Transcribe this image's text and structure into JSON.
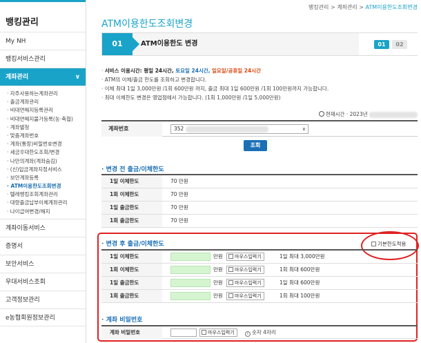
{
  "sidebar": {
    "title": "뱅킹관리",
    "items_top": [
      "My NH",
      "뱅킹서비스관리"
    ],
    "active": {
      "label": "계좌관리",
      "chevron": "∨"
    },
    "subitems": [
      "자주사용하는계좌관리",
      "출금계좌관리",
      "비대면해지등록관리",
      "비대면해지불가등록(농·축협)",
      "계좌별청",
      "맞춤계좌번호",
      "계좌(통장)비밀번호변경",
      "세금우대한도조회/변경",
      "나만의계좌(계좌숨김)",
      "(신)입금계좌지정서비스",
      "보안계좌등록",
      "ATM이용한도조회변경",
      "텔레뱅킹조회계좌관리",
      "대량출금납부이체계좌관리",
      "나이급여변경/해지"
    ],
    "subitem_active_index": 11,
    "items_bottom": [
      "계좌이동서비스",
      "증명서",
      "보안서비스",
      "우대서비스조회",
      "고객정보관리",
      "e농협회원정보관리"
    ]
  },
  "breadcrumb": {
    "home": "뱅킹관리",
    "sep": " > ",
    "level2": "계좌관리",
    "current": "ATM이용한도조회변경"
  },
  "page_title": "ATM이용한도조회변경",
  "steps": {
    "current_num": "01",
    "current_label": "ATM이용한도 변경",
    "pill_on": "01",
    "pill_off": "02"
  },
  "notes": {
    "hours_prefix": "서비스 이용시간: 평일 24시간,",
    "hours_sat": "토요일 24시간,",
    "hours_hol": "일요일/공휴일 24시간",
    "line2": "ATM의 이체/출금 한도를 조회하고 변경합니다.",
    "line3": "이체 최대 1일 3,000만원 /1회 600만원 까지, 출금 최대 1일 600만원 /1회 100만원까지 가능합니다.",
    "line4": "최대 이체한도 변경은 영업점에서 가능합니다. (1회 1,000만원 /1일 5,000만원)"
  },
  "current_time": "현재시간 · 2023년",
  "account": {
    "label": "계좌번호",
    "selected_prefix": "352",
    "dropdown_icon": "∨"
  },
  "lookup_button": "조회",
  "before": {
    "title": "변경 전 출금/이체한도",
    "rows": [
      {
        "label": "1일 이체한도",
        "value": "70 만원"
      },
      {
        "label": "1회 이체한도",
        "value": "70 만원"
      },
      {
        "label": "1일 출금한도",
        "value": "70 만원"
      },
      {
        "label": "1회 출금한도",
        "value": "70 만원"
      }
    ]
  },
  "after": {
    "title": "변경 후 출금/이체한도",
    "default_limit_label": "기본한도적용",
    "unit": "만원",
    "mouse_label": "마우스입력기",
    "rows": [
      {
        "label": "1일 이체한도",
        "max": "1일 최대 3,000만원"
      },
      {
        "label": "1회 이체한도",
        "max": "1회 최대 600만원"
      },
      {
        "label": "1일 출금한도",
        "max": "1일 최대 600만원"
      },
      {
        "label": "1회 출금한도",
        "max": "1회 최대 100만원"
      }
    ]
  },
  "password": {
    "title": "계좌 비밀번호",
    "label": "계좌 비밀번호",
    "mouse_label": "마우스입력기",
    "info_icon": "i",
    "info": "숫자 4자리"
  },
  "colors": {
    "accent": "#1aa3c8",
    "link_blue": "#1a6fb5",
    "highlight_red": "#e02020",
    "input_green": "#d5f5d0"
  }
}
